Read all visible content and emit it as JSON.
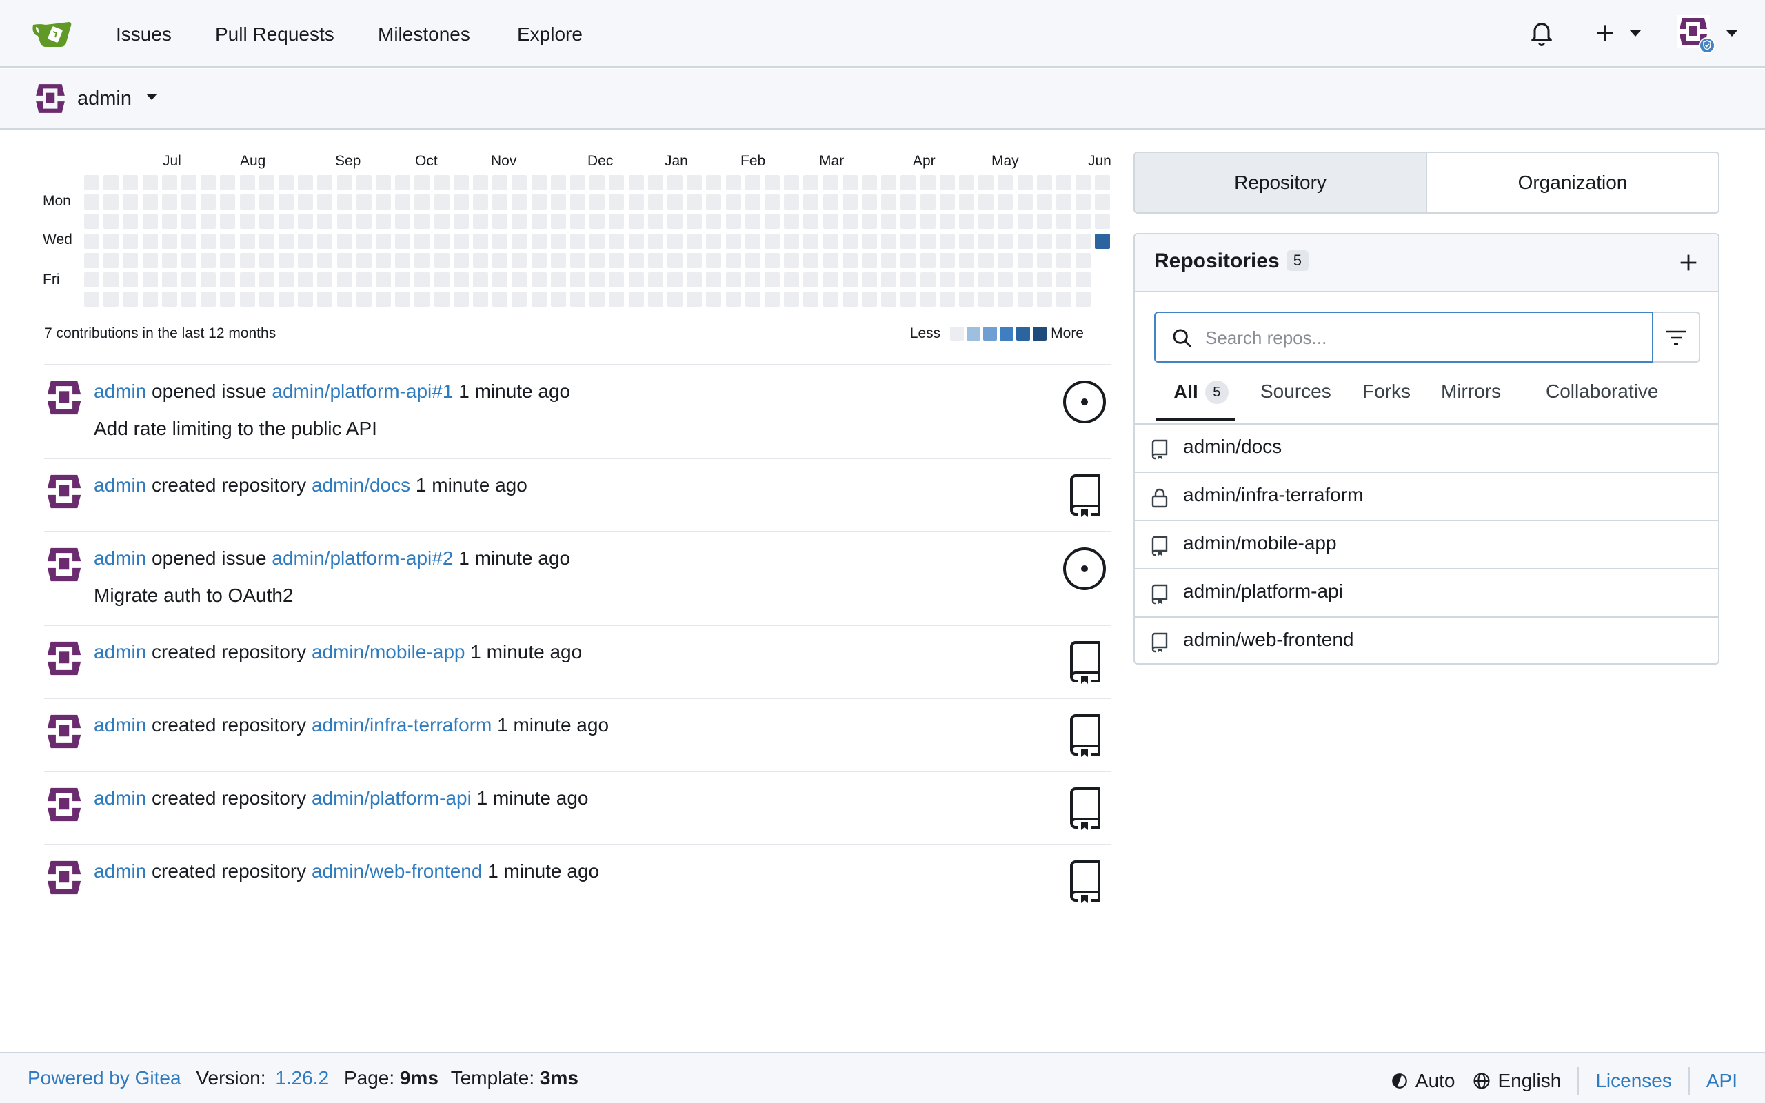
{
  "nav": {
    "items": [
      "Issues",
      "Pull Requests",
      "Milestones",
      "Explore"
    ]
  },
  "context": {
    "user": "admin"
  },
  "heatmap": {
    "months": [
      "Jul",
      "Aug",
      "Sep",
      "Oct",
      "Nov",
      "Dec",
      "Jan",
      "Feb",
      "Mar",
      "Apr",
      "May",
      "Jun"
    ],
    "days": [
      "Mon",
      "Wed",
      "Fri"
    ],
    "summary": "7 contributions in the last 12 months",
    "legend_less": "Less",
    "legend_more": "More",
    "colors": [
      "#ebedf0",
      "#9ebfe0",
      "#6fa0d3",
      "#3f7fc1",
      "#2c64a0",
      "#1e4a7c"
    ]
  },
  "feed": [
    {
      "user": "admin",
      "action": "opened issue",
      "target": "admin/platform-api#1",
      "time": "1 minute ago",
      "detail": "Add rate limiting to the public API",
      "icon": "issue-open-icon"
    },
    {
      "user": "admin",
      "action": "created repository",
      "target": "admin/docs",
      "time": "1 minute ago",
      "detail": "",
      "icon": "repo-icon"
    },
    {
      "user": "admin",
      "action": "opened issue",
      "target": "admin/platform-api#2",
      "time": "1 minute ago",
      "detail": "Migrate auth to OAuth2",
      "icon": "issue-open-icon"
    },
    {
      "user": "admin",
      "action": "created repository",
      "target": "admin/mobile-app",
      "time": "1 minute ago",
      "detail": "",
      "icon": "repo-icon"
    },
    {
      "user": "admin",
      "action": "created repository",
      "target": "admin/infra-terraform",
      "time": "1 minute ago",
      "detail": "",
      "icon": "repo-icon"
    },
    {
      "user": "admin",
      "action": "created repository",
      "target": "admin/platform-api",
      "time": "1 minute ago",
      "detail": "",
      "icon": "repo-icon"
    },
    {
      "user": "admin",
      "action": "created repository",
      "target": "admin/web-frontend",
      "time": "1 minute ago",
      "detail": "",
      "icon": "repo-icon"
    }
  ],
  "switcher": {
    "repository": "Repository",
    "organization": "Organization"
  },
  "repos": {
    "title": "Repositories",
    "count": "5",
    "search_placeholder": "Search repos...",
    "tabs": [
      "All",
      "Sources",
      "Forks",
      "Mirrors",
      "Collaborative"
    ],
    "all_count": "5",
    "items": [
      {
        "name": "admin/docs",
        "private": false
      },
      {
        "name": "admin/infra-terraform",
        "private": true
      },
      {
        "name": "admin/mobile-app",
        "private": false
      },
      {
        "name": "admin/platform-api",
        "private": false
      },
      {
        "name": "admin/web-frontend",
        "private": false
      }
    ]
  },
  "footer": {
    "powered": "Powered by Gitea",
    "version_label": "Version:",
    "version": "1.26.2",
    "page_label": "Page:",
    "page_time": "9ms",
    "template_label": "Template:",
    "template_time": "3ms",
    "theme": "Auto",
    "language": "English",
    "licenses": "Licenses",
    "api": "API"
  }
}
